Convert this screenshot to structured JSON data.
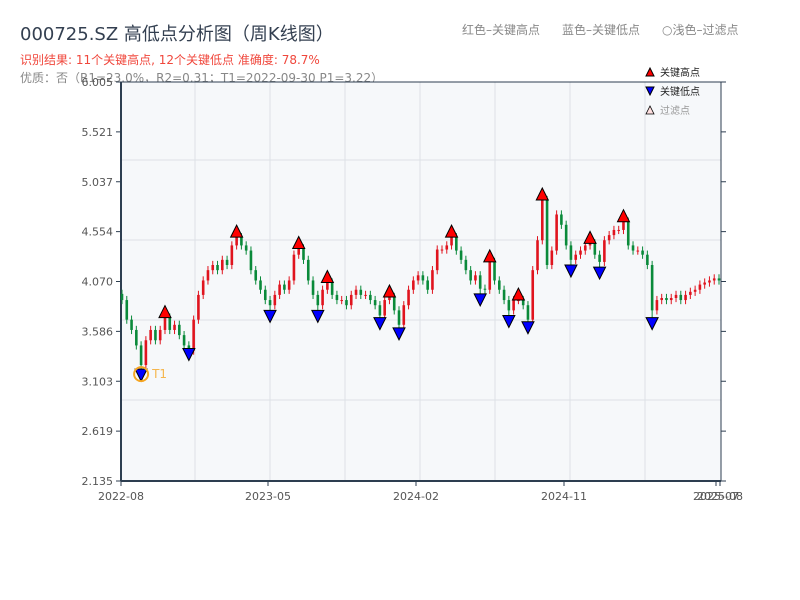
{
  "title": "000725.SZ 高低点分析图（周K线图）",
  "result_text": "识别结果: 11个关键高点, 12个关键低点   准确度: 78.7%",
  "quality_text": "优质：否（R1=23.0%，R2=0.31；T1=2022-09-30 P1=3.22）",
  "key_note": {
    "red": "红色–关键高点",
    "blue": "蓝色–关键低点",
    "light": "○浅色–过滤点"
  },
  "colors": {
    "up": "#e0141e",
    "down": "#0a8a3a",
    "high_marker": "#ff0000",
    "low_marker": "#0000ff",
    "t1": "#f5a623",
    "plot_bg": "#f6f8fa",
    "axis": "#2d3e50"
  },
  "chart_data": {
    "type": "candlestick",
    "title": "000725.SZ 高低点分析图（周K线图）",
    "ylim": [
      2.135,
      6.005
    ],
    "yticks": [
      "6.005",
      "5.521",
      "5.037",
      "4.554",
      "4.070",
      "3.586",
      "3.103",
      "2.619",
      "2.135"
    ],
    "xticks": [
      "2022-08",
      "2023-05",
      "2024-02",
      "2024-11",
      "2025-07",
      "2025-08"
    ],
    "grid": true,
    "legend_position": "top-right",
    "legend": [
      {
        "label": "关键高点",
        "symbol": "triangle-up",
        "color": "#ff0000"
      },
      {
        "label": "关键低点",
        "symbol": "triangle-down",
        "color": "#0000ff"
      },
      {
        "label": "过滤点",
        "symbol": "triangle-up-light",
        "color": "#ffe0e0"
      }
    ],
    "closes": [
      3.89,
      3.7,
      3.6,
      3.45,
      3.26,
      3.5,
      3.6,
      3.5,
      3.6,
      3.72,
      3.6,
      3.65,
      3.55,
      3.45,
      3.4,
      3.7,
      3.94,
      4.08,
      4.18,
      4.23,
      4.18,
      4.28,
      4.23,
      4.42,
      4.5,
      4.42,
      4.37,
      4.18,
      4.08,
      3.99,
      3.89,
      3.84,
      3.94,
      4.04,
      3.99,
      4.08,
      4.33,
      4.39,
      4.28,
      4.08,
      3.94,
      3.84,
      3.99,
      4.06,
      3.94,
      3.89,
      3.89,
      3.84,
      3.94,
      3.99,
      3.94,
      3.94,
      3.89,
      3.84,
      3.74,
      3.89,
      3.92,
      3.79,
      3.65,
      3.84,
      3.99,
      4.08,
      4.13,
      4.08,
      3.99,
      4.18,
      4.38,
      4.38,
      4.42,
      4.5,
      4.37,
      4.28,
      4.18,
      4.08,
      4.13,
      4.0,
      3.99,
      4.26,
      4.08,
      3.99,
      3.89,
      3.79,
      3.89,
      3.89,
      3.84,
      3.7,
      4.18,
      4.47,
      4.86,
      4.23,
      4.37,
      4.72,
      4.62,
      4.42,
      4.28,
      4.33,
      4.37,
      4.42,
      4.44,
      4.33,
      4.26,
      4.47,
      4.52,
      4.57,
      4.57,
      4.65,
      4.42,
      4.37,
      4.37,
      4.33,
      4.23,
      3.79,
      3.89,
      3.91,
      3.89,
      3.91,
      3.94,
      3.89,
      3.94,
      3.97,
      3.99,
      4.04,
      4.06,
      4.08,
      4.1,
      4.08
    ],
    "open_first": 3.95,
    "key_highs": [
      {
        "i": 9,
        "price": 3.72
      },
      {
        "i": 24,
        "price": 4.5
      },
      {
        "i": 37,
        "price": 4.39
      },
      {
        "i": 43,
        "price": 4.06
      },
      {
        "i": 56,
        "price": 3.92
      },
      {
        "i": 69,
        "price": 4.5
      },
      {
        "i": 77,
        "price": 4.26
      },
      {
        "i": 83,
        "price": 3.89
      },
      {
        "i": 88,
        "price": 4.86
      },
      {
        "i": 98,
        "price": 4.44
      },
      {
        "i": 105,
        "price": 4.65
      }
    ],
    "key_lows": [
      {
        "i": 4,
        "price": 3.22
      },
      {
        "i": 14,
        "price": 3.42
      },
      {
        "i": 31,
        "price": 3.79
      },
      {
        "i": 41,
        "price": 3.79
      },
      {
        "i": 54,
        "price": 3.72
      },
      {
        "i": 58,
        "price": 3.62
      },
      {
        "i": 75,
        "price": 3.95
      },
      {
        "i": 81,
        "price": 3.74
      },
      {
        "i": 85,
        "price": 3.68
      },
      {
        "i": 94,
        "price": 4.23
      },
      {
        "i": 100,
        "price": 4.21
      },
      {
        "i": 111,
        "price": 3.72
      }
    ],
    "annotation": {
      "label": "T1",
      "date": "2022-09-30",
      "price": 3.22,
      "i": 4
    }
  }
}
